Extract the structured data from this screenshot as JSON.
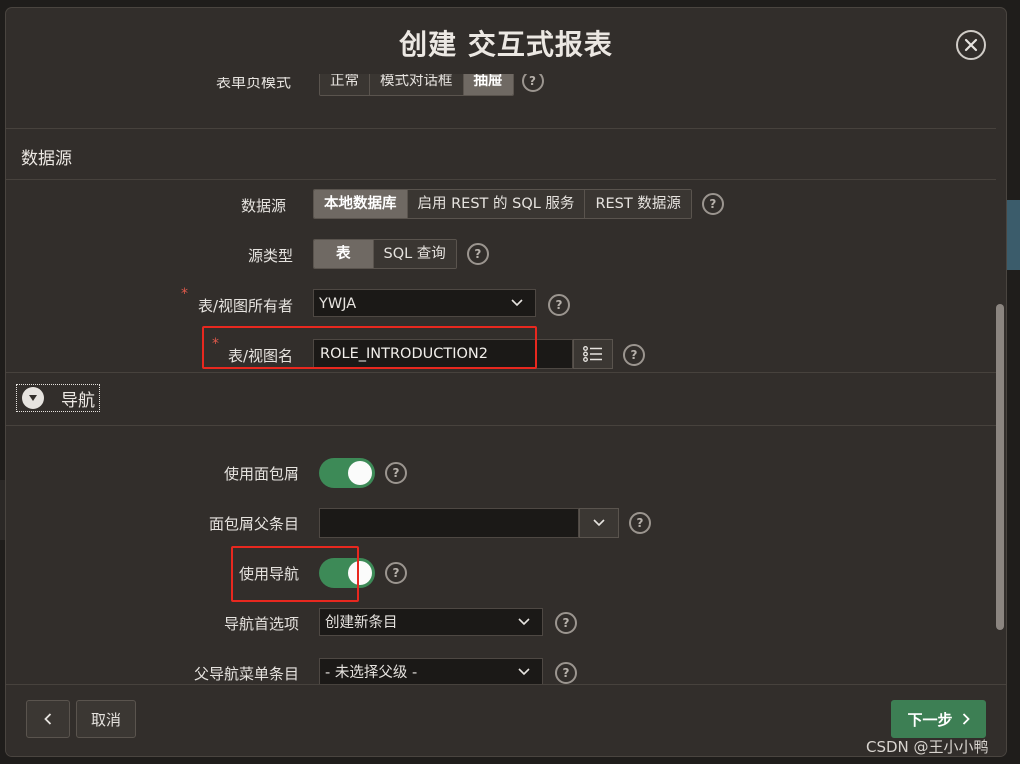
{
  "dialog": {
    "title": "创建 交互式报表",
    "close_label": "close"
  },
  "form_page_mode": {
    "label": "表单页模式",
    "options": [
      "正常",
      "模式对话框",
      "抽屉"
    ],
    "active_index": 2
  },
  "data_source_section": {
    "heading": "数据源",
    "data_source": {
      "label": "数据源",
      "options": [
        "本地数据库",
        "启用 REST 的 SQL 服务",
        "REST 数据源"
      ],
      "active_index": 0
    },
    "source_type": {
      "label": "源类型",
      "options": [
        "表",
        "SQL 查询"
      ],
      "active_index": 0
    },
    "owner": {
      "label": "表/视图所有者",
      "required_mark": "*",
      "value": "YWJA"
    },
    "table_name": {
      "label": "表/视图名",
      "required_mark": "*",
      "value": "ROLE_INTRODUCTION2"
    }
  },
  "navigation_section": {
    "heading": "导航",
    "use_breadcrumb": {
      "label": "使用面包屑",
      "on": true
    },
    "breadcrumb_parent": {
      "label": "面包屑父条目",
      "value": ""
    },
    "use_navigation": {
      "label": "使用导航",
      "on": true
    },
    "nav_preference": {
      "label": "导航首选项",
      "value": "创建新条目"
    },
    "parent_nav_entry": {
      "label": "父导航菜单条目",
      "value": "- 未选择父级 -"
    }
  },
  "help_glyph": "?",
  "footer": {
    "cancel_label": "取消",
    "next_label": "下一步"
  },
  "watermark": "CSDN @王小小鸭"
}
